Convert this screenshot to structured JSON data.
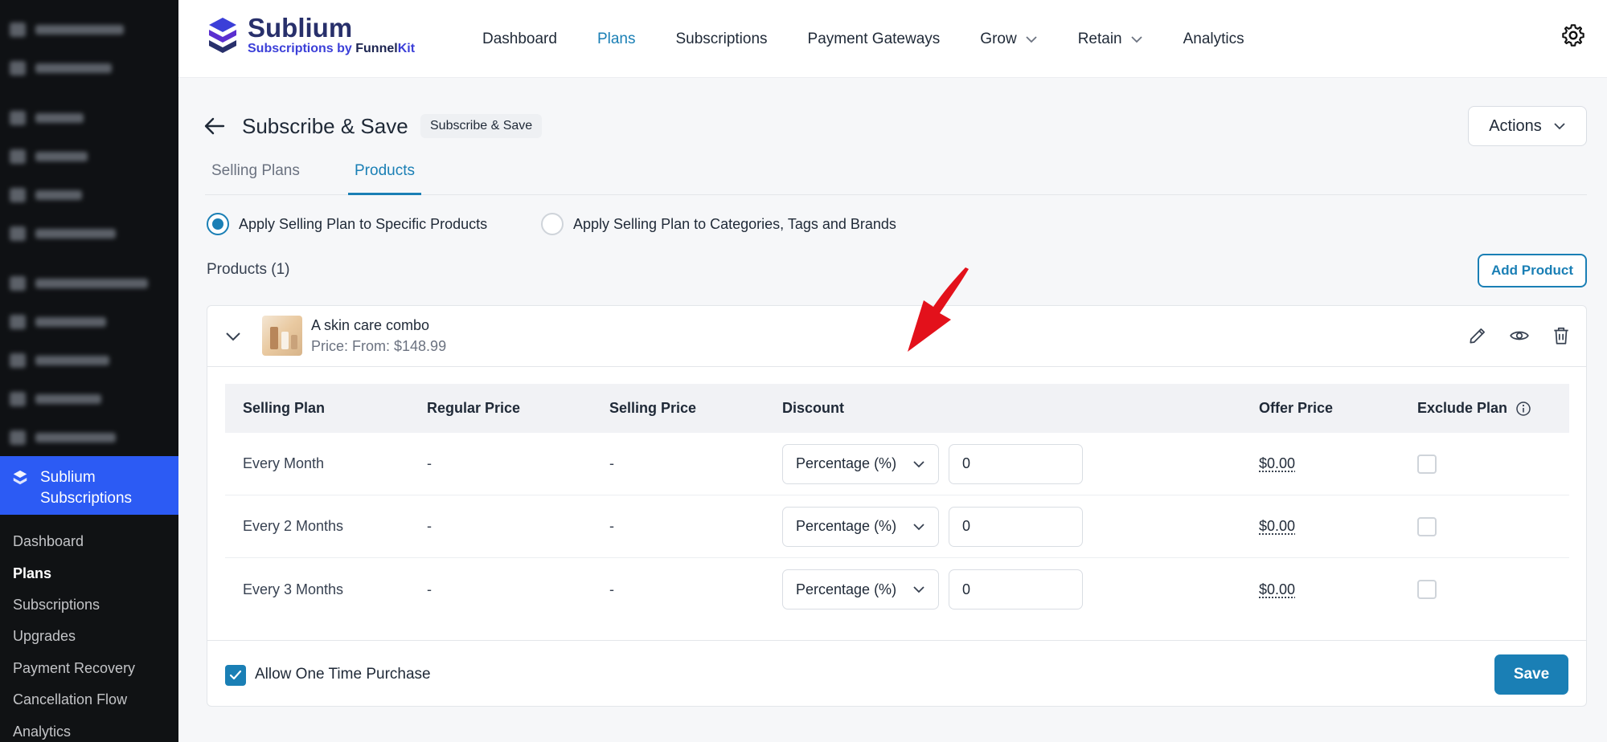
{
  "sidebar": {
    "active_menu": "Sublium Subscriptions",
    "sub_items": [
      {
        "label": "Dashboard"
      },
      {
        "label": "Plans"
      },
      {
        "label": "Subscriptions"
      },
      {
        "label": "Upgrades"
      },
      {
        "label": "Payment Recovery"
      },
      {
        "label": "Cancellation Flow"
      },
      {
        "label": "Analytics"
      }
    ],
    "active_sub_item": "Plans"
  },
  "brand": {
    "name": "Sublium",
    "tagline_prefix": "Subscriptions by ",
    "tagline_funnel": "Funnel",
    "tagline_kit": "Kit",
    "accent": "#1a7fb5",
    "logo_color": "#3b3fd8"
  },
  "nav": {
    "items": [
      {
        "label": "Dashboard"
      },
      {
        "label": "Plans"
      },
      {
        "label": "Subscriptions"
      },
      {
        "label": "Payment Gateways"
      },
      {
        "label": "Grow"
      },
      {
        "label": "Retain"
      },
      {
        "label": "Analytics"
      }
    ],
    "active": "Plans",
    "settings_icon": "gear-icon"
  },
  "page": {
    "title": "Subscribe & Save",
    "badge": "Subscribe & Save",
    "actions_label": "Actions"
  },
  "tabs": {
    "selling_plans": "Selling Plans",
    "products": "Products",
    "active": "Products"
  },
  "apply": {
    "option_specific": "Apply Selling Plan to Specific Products",
    "option_categories": "Apply Selling Plan to Categories, Tags and Brands",
    "selected": "option_specific"
  },
  "products": {
    "count_label": "Products (1)",
    "add_button": "Add Product",
    "item": {
      "name": "A skin care combo",
      "price": "Price: From: $148.99"
    }
  },
  "table": {
    "headers": {
      "selling_plan": "Selling Plan",
      "regular_price": "Regular Price",
      "selling_price": "Selling Price",
      "discount": "Discount",
      "offer_price": "Offer Price",
      "exclude_plan": "Exclude Plan"
    },
    "rows": [
      {
        "plan": "Every Month",
        "regular": "-",
        "selling": "-",
        "discount_type": "Percentage (%)",
        "discount_value": "0",
        "offer": "$0.00",
        "excluded": false
      },
      {
        "plan": "Every 2 Months",
        "regular": "-",
        "selling": "-",
        "discount_type": "Percentage (%)",
        "discount_value": "0",
        "offer": "$0.00",
        "excluded": false
      },
      {
        "plan": "Every 3 Months",
        "regular": "-",
        "selling": "-",
        "discount_type": "Percentage (%)",
        "discount_value": "0",
        "offer": "$0.00",
        "excluded": false
      }
    ]
  },
  "footer": {
    "one_time_label": "Allow One Time Purchase",
    "one_time_checked": true,
    "save_label": "Save"
  },
  "annotation_color": "#e3111b"
}
